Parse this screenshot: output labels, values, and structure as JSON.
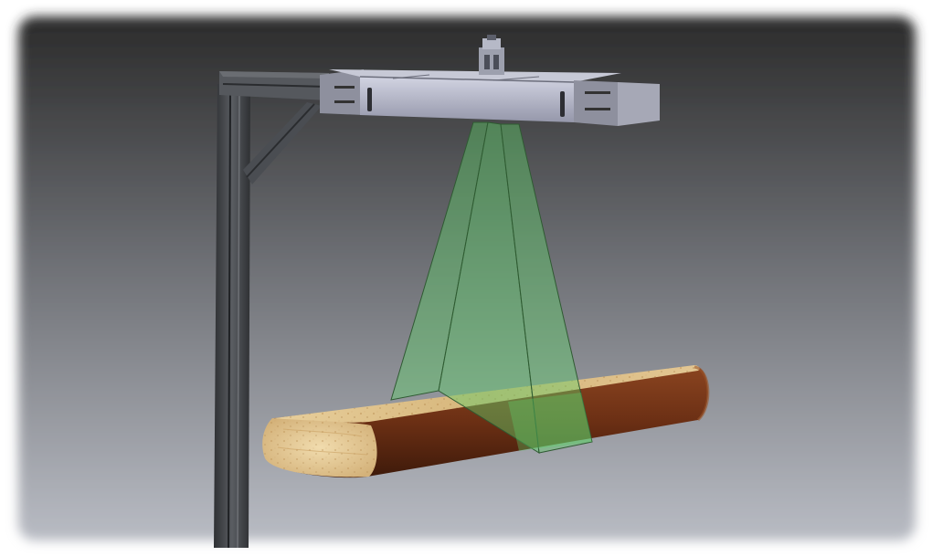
{
  "scene": {
    "subject": "log-scanner-rig",
    "colors": {
      "backdrop_top": "#2b2b2b",
      "backdrop_bottom": "#b9bcc4",
      "frame_steel": "#4a4d52",
      "scanner_housing": "#b4b6c8",
      "scan_beam": "#5fcf6a",
      "log_wood_light": "#e3c793",
      "log_bark": "#6b2f14"
    },
    "icons": {
      "frame": "gantry-post-icon",
      "sensor": "scanner-head-icon",
      "beam": "laser-beam-icon",
      "log": "timber-log-icon"
    }
  }
}
